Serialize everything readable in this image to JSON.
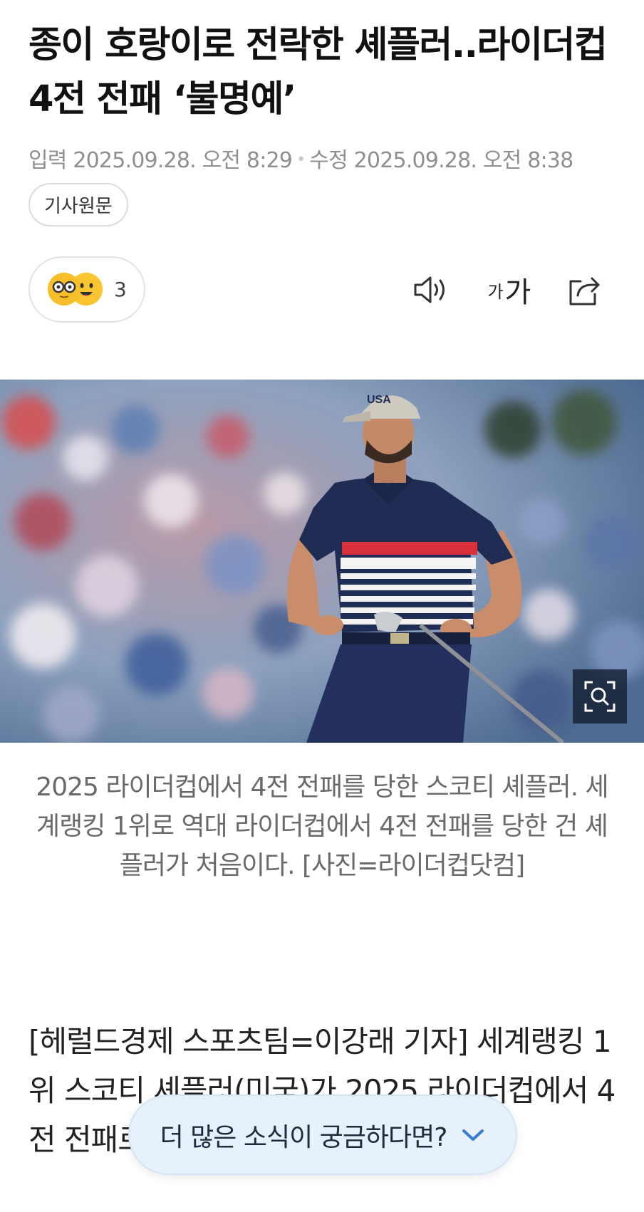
{
  "article": {
    "title": "종이 호랑이로 전락한 셰플러..라이더컵 4전 전패 ‘불명예’",
    "input_time": "입력 2025.09.28. 오전 8:29",
    "edit_time": "수정 2025.09.28. 오전 8:38",
    "original_button": "기사원문"
  },
  "toolbar": {
    "reaction_count": "3",
    "font_small": "가",
    "font_large": "가",
    "icons": [
      "speaker-icon",
      "font-size-icon",
      "share-icon"
    ]
  },
  "photo": {
    "caption": "2025 라이더컵에서 4전 전패를 당한 스코티 셰플러. 세계랭킹 1위로 역대 라이더컵에서 4전 전패를 당한 건 셰플러가 처음이다. [사진=라이더컵닷컴]",
    "cap_logo": "USA"
  },
  "body": {
    "paragraph": "[헤럴드경제 스포츠팀=이강래 기자] 세계랭킹 1위 스코티 셰플러(미국)가 2025 라이더컵에서 4전 전패로 종이 호랑이로 전락했다."
  },
  "more_news": {
    "label": "더 많은 소식이 궁금하다면?"
  },
  "colors": {
    "accent": "#3a7bd5",
    "pill_bg": "#e6f1fc",
    "meta": "#8f8f8f"
  }
}
